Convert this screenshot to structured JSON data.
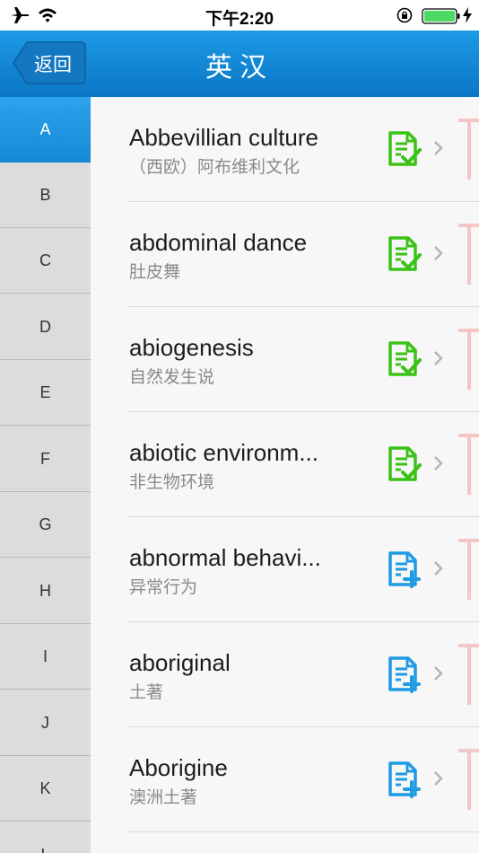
{
  "status_bar": {
    "time": "下午2:20",
    "icons": [
      "airplane-icon",
      "wifi-icon",
      "rotation-lock-icon",
      "battery-icon",
      "charging-bolt-icon"
    ],
    "battery_color": "#4cd964"
  },
  "nav": {
    "back_label": "返回",
    "title": "英汉",
    "color": "#1588d5"
  },
  "alphabet": {
    "letters": [
      "A",
      "B",
      "C",
      "D",
      "E",
      "F",
      "G",
      "H",
      "I",
      "J",
      "K",
      "L"
    ],
    "selected": "A"
  },
  "words": [
    {
      "word": "Abbevillian culture",
      "meaning": "（西欧）阿布维利文化",
      "status": "learned"
    },
    {
      "word": "abdominal dance",
      "meaning": "肚皮舞",
      "status": "learned"
    },
    {
      "word": "abiogenesis",
      "meaning": "自然发生说",
      "status": "learned"
    },
    {
      "word": "abiotic environm...",
      "meaning": "非生物环境",
      "status": "learned"
    },
    {
      "word": "abnormal behavi...",
      "meaning": "异常行为",
      "status": "add"
    },
    {
      "word": "aboriginal",
      "meaning": "土著",
      "status": "add"
    },
    {
      "word": "Aborigine",
      "meaning": "澳洲土著",
      "status": "add"
    }
  ],
  "colors": {
    "learned_icon": "#3cc216",
    "add_icon": "#1e9be3",
    "chevron": "#b5b5b5",
    "edge_mark": "#f4c6c6"
  }
}
